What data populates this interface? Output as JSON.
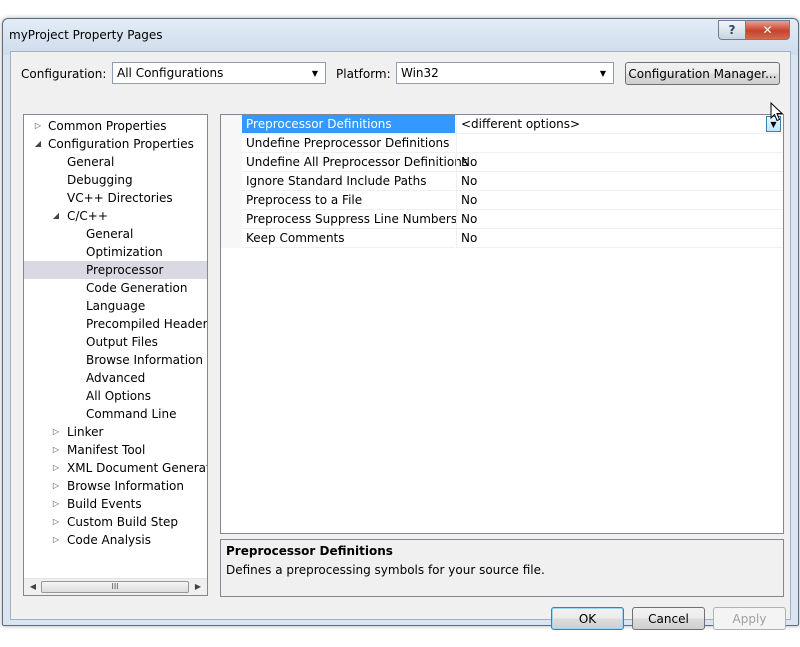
{
  "window": {
    "title": "myProject Property Pages",
    "help_label": "?",
    "close_label": "✕"
  },
  "config": {
    "configuration_label": "Configuration:",
    "configuration_value": "All Configurations",
    "platform_label": "Platform:",
    "platform_value": "Win32",
    "manager_button": "Configuration Manager..."
  },
  "tree": {
    "items": [
      {
        "label": "Common Properties",
        "level": 0,
        "expander": "collapsed"
      },
      {
        "label": "Configuration Properties",
        "level": 0,
        "expander": "expanded"
      },
      {
        "label": "General",
        "level": 1
      },
      {
        "label": "Debugging",
        "level": 1
      },
      {
        "label": "VC++ Directories",
        "level": 1
      },
      {
        "label": "C/C++",
        "level": 1,
        "expander": "expanded"
      },
      {
        "label": "General",
        "level": 2
      },
      {
        "label": "Optimization",
        "level": 2
      },
      {
        "label": "Preprocessor",
        "level": 2,
        "selected": true
      },
      {
        "label": "Code Generation",
        "level": 2
      },
      {
        "label": "Language",
        "level": 2
      },
      {
        "label": "Precompiled Headers",
        "level": 2
      },
      {
        "label": "Output Files",
        "level": 2
      },
      {
        "label": "Browse Information",
        "level": 2
      },
      {
        "label": "Advanced",
        "level": 2
      },
      {
        "label": "All Options",
        "level": 2
      },
      {
        "label": "Command Line",
        "level": 2
      },
      {
        "label": "Linker",
        "level": 1,
        "expander": "collapsed"
      },
      {
        "label": "Manifest Tool",
        "level": 1,
        "expander": "collapsed"
      },
      {
        "label": "XML Document Generator",
        "level": 1,
        "expander": "collapsed"
      },
      {
        "label": "Browse Information",
        "level": 1,
        "expander": "collapsed"
      },
      {
        "label": "Build Events",
        "level": 1,
        "expander": "collapsed"
      },
      {
        "label": "Custom Build Step",
        "level": 1,
        "expander": "collapsed"
      },
      {
        "label": "Code Analysis",
        "level": 1,
        "expander": "collapsed"
      }
    ],
    "scroll_thumb_grip": "III"
  },
  "properties": [
    {
      "name": "Preprocessor Definitions",
      "value": "<different options>",
      "selected": true
    },
    {
      "name": "Undefine Preprocessor Definitions",
      "value": ""
    },
    {
      "name": "Undefine All Preprocessor Definitions",
      "value": "No"
    },
    {
      "name": "Ignore Standard Include Paths",
      "value": "No"
    },
    {
      "name": "Preprocess to a File",
      "value": "No"
    },
    {
      "name": "Preprocess Suppress Line Numbers",
      "value": "No"
    },
    {
      "name": "Keep Comments",
      "value": "No"
    }
  ],
  "description": {
    "title": "Preprocessor Definitions",
    "text": "Defines a preprocessing symbols for your source file."
  },
  "buttons": {
    "ok": "OK",
    "cancel": "Cancel",
    "apply": "Apply"
  }
}
